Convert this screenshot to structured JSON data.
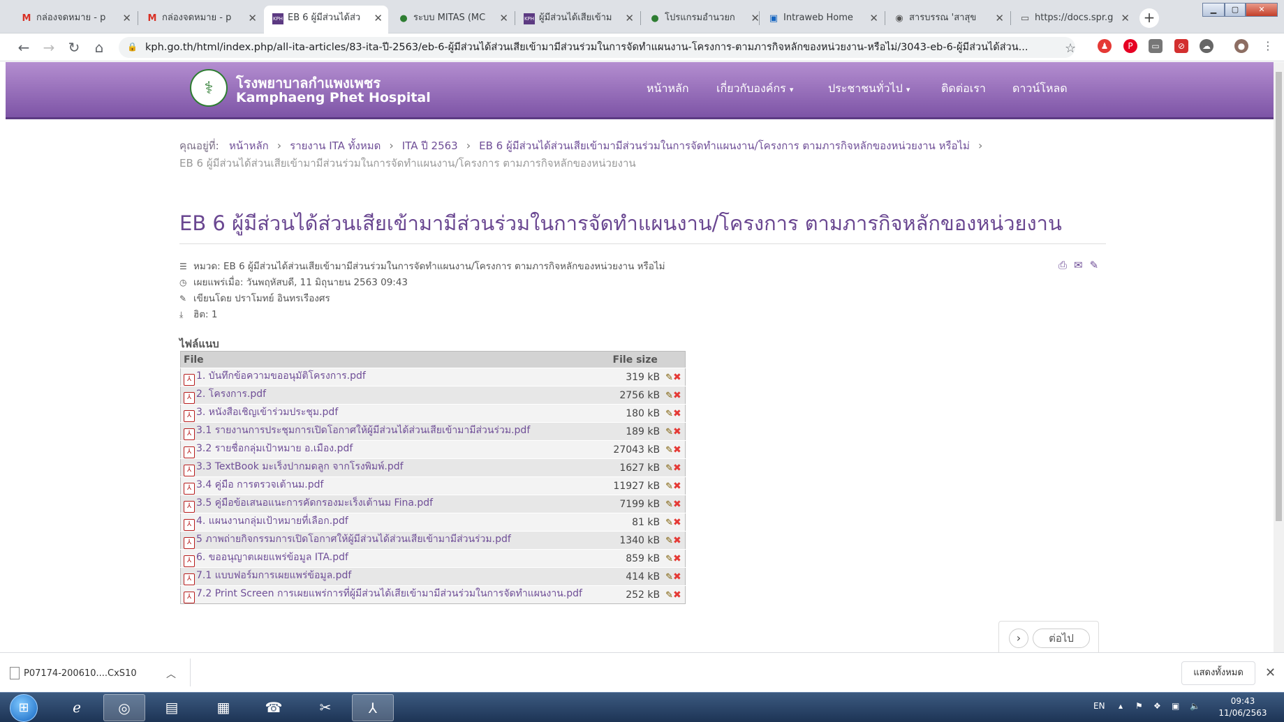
{
  "browser": {
    "tabs": [
      {
        "label": "กล่องจดหมาย - p",
        "icon": "gmail-icon",
        "active": false
      },
      {
        "label": "กล่องจดหมาย - p",
        "icon": "gmail-icon",
        "active": false
      },
      {
        "label": "EB 6 ผู้มีส่วนได้ส่ว",
        "icon": "kph-icon",
        "active": true
      },
      {
        "label": "ระบบ MITAS (MC",
        "icon": "globe-icon",
        "active": false
      },
      {
        "label": "ผู้มีส่วนได้เสียเข้าม",
        "icon": "kph-icon",
        "active": false
      },
      {
        "label": "โปรแกรมอำนวยก",
        "icon": "globe-icon",
        "active": false
      },
      {
        "label": "Intraweb Home",
        "icon": "intraweb-icon",
        "active": false
      },
      {
        "label": "สารบรรณ 'สาสุข",
        "icon": "globe-icon",
        "active": false
      },
      {
        "label": "https://docs.spr.g",
        "icon": "doc-icon",
        "active": false
      }
    ],
    "url": "kph.go.th/html/index.php/all-ita-articles/83-ita-ปี-2563/eb-6-ผู้มีส่วนได้ส่วนเสียเข้ามามีส่วนร่วมในการจัดทำแผนงาน-โครงการ-ตามภารกิจหลักของหน่วยงาน-หรือไม่/3043-eb-6-ผู้มีส่วนได้ส่วน..."
  },
  "site": {
    "name_th": "โรงพยาบาลกำแพงเพชร",
    "name_en": "Kamphaeng Phet Hospital",
    "menu": [
      "หน้าหลัก",
      "เกี่ยวกับองค์กร",
      "ประชาชนทั่วไป",
      "ติดต่อเรา",
      "ดาวน์โหลด"
    ]
  },
  "breadcrumb": {
    "prefix": "คุณอยู่ที่:",
    "items": [
      "หน้าหลัก",
      "รายงาน ITA ทั้งหมด",
      "ITA ปี 2563",
      "EB 6 ผู้มีส่วนได้ส่วนเสียเข้ามามีส่วนร่วมในการจัดทำแผนงาน/โครงการ ตามภารกิจหลักของหน่วยงาน หรือไม่"
    ],
    "current": "EB 6 ผู้มีส่วนได้ส่วนเสียเข้ามามีส่วนร่วมในการจัดทำแผนงาน/โครงการ ตามภารกิจหลักของหน่วยงาน"
  },
  "article": {
    "title": "EB 6 ผู้มีส่วนได้ส่วนเสียเข้ามามีส่วนร่วมในการจัดทำแผนงาน/โครงการ ตามภารกิจหลักของหน่วยงาน",
    "category": "หมวด: EB 6 ผู้มีส่วนได้ส่วนเสียเข้ามามีส่วนร่วมในการจัดทำแผนงาน/โครงการ ตามภารกิจหลักของหน่วยงาน หรือไม่",
    "published": "เผยแพร่เมื่อ: วันพฤหัสบดี, 11 มิถุนายน 2563 09:43",
    "author": "เขียนโดย ปราโมทย์ อินทรเรืองศร",
    "hits": "ฮิต: 1"
  },
  "attachments": {
    "heading": "ไฟล์แนบ",
    "col_file": "File",
    "col_size": "File size",
    "rows": [
      {
        "name": "1. บันทึกข้อความขออนุมัติโครงการ.pdf",
        "size": "319 kB"
      },
      {
        "name": "2. โครงการ.pdf",
        "size": "2756 kB"
      },
      {
        "name": "3. หนังสือเชิญเข้าร่วมประชุม.pdf",
        "size": "180 kB"
      },
      {
        "name": "3.1 รายงานการประชุมการเปิดโอกาศให้ผู้มีส่วนได้ส่วนเสียเข้ามามีส่วนร่วม.pdf",
        "size": "189 kB"
      },
      {
        "name": "3.2 รายชื่อกลุ่มเป้าหมาย อ.เมือง.pdf",
        "size": "27043 kB"
      },
      {
        "name": "3.3 TextBook มะเร็งปากมดลูก จากโรงพิมพ์.pdf",
        "size": "1627 kB"
      },
      {
        "name": "3.4 คู่มือ การตรวจเต้านม.pdf",
        "size": "11927 kB"
      },
      {
        "name": "3.5 คู่มือข้อเสนอแนะการคัดกรองมะเร็งเต้านม Fina.pdf",
        "size": "7199 kB"
      },
      {
        "name": "4. แผนงานกลุ่มเป้าหมายที่เลือก.pdf",
        "size": "81 kB"
      },
      {
        "name": "5 ภาพถ่ายกิจกรรมการเปิดโอกาศให้ผู้มีส่วนได้ส่วนเสียเข้ามามีส่วนร่วม.pdf",
        "size": "1340 kB"
      },
      {
        "name": "6. ขออนุญาตเผยแพร่ข้อมูล ITA.pdf",
        "size": "859 kB"
      },
      {
        "name": "7.1 แบบฟอร์มการเผยแพร่ข้อมูล.pdf",
        "size": "414 kB"
      },
      {
        "name": "7.2 Print Screen การเผยแพร่การที่ผู้มีส่วนได้เสียเข้ามามีส่วนร่วมในการจัดทำแผนงาน.pdf",
        "size": "252 kB"
      }
    ]
  },
  "pager": {
    "next": "ต่อไป"
  },
  "download_bar": {
    "file": "P07174-200610....CxS10",
    "show_all": "แสดงทั้งหมด"
  },
  "taskbar": {
    "lang": "EN",
    "time": "09:43",
    "date": "11/06/2563"
  }
}
